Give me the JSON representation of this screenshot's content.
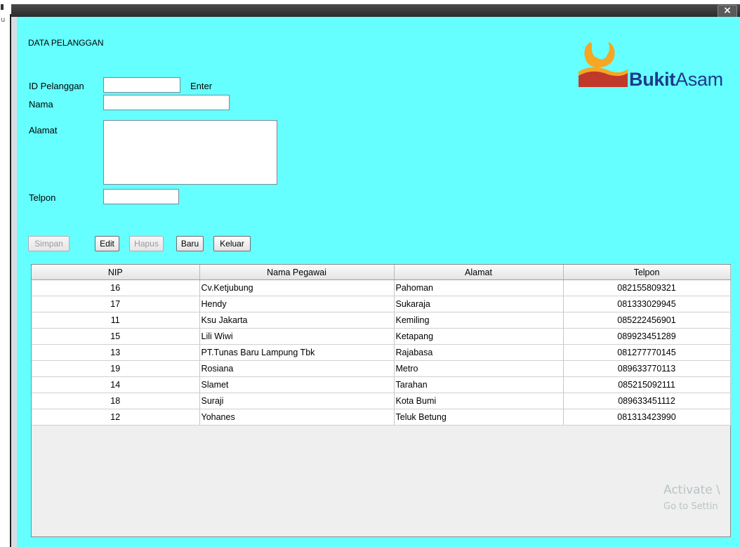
{
  "desktop": {
    "left_char": "u"
  },
  "window": {
    "close_glyph": "×"
  },
  "form": {
    "title": "DATA PELANGGAN",
    "id_label": "ID Pelanggan",
    "id_value": "",
    "enter_label": "Enter",
    "nama_label": "Nama",
    "nama_value": "",
    "alamat_label": "Alamat",
    "alamat_value": "",
    "telpon_label": "Telpon",
    "telpon_value": ""
  },
  "logo": {
    "brand_bold": "Bukit",
    "brand_light": "Asam",
    "colors": {
      "orange": "#f5a623",
      "red": "#c0392b",
      "blue": "#1b3a8c"
    }
  },
  "buttons": {
    "simpan": {
      "label": "Simpan",
      "enabled": false
    },
    "edit": {
      "label": "Edit",
      "enabled": true
    },
    "hapus": {
      "label": "Hapus",
      "enabled": false
    },
    "baru": {
      "label": "Baru",
      "enabled": true
    },
    "keluar": {
      "label": "Keluar",
      "enabled": true
    }
  },
  "table": {
    "headers": [
      "NIP",
      "Nama Pegawai",
      "Alamat",
      "Telpon"
    ],
    "rows": [
      [
        "16",
        "Cv.Ketjubung",
        "Pahoman",
        "082155809321"
      ],
      [
        "17",
        "Hendy",
        "Sukaraja",
        "081333029945"
      ],
      [
        "11",
        "Ksu Jakarta",
        "Kemiling",
        "085222456901"
      ],
      [
        "15",
        "Lili Wiwi",
        "Ketapang",
        "089923451289"
      ],
      [
        "13",
        "PT.Tunas Baru Lampung Tbk",
        "Rajabasa",
        "081277770145"
      ],
      [
        "19",
        "Rosiana",
        "Metro",
        "089633770113"
      ],
      [
        "14",
        "Slamet",
        "Tarahan",
        "085215092111"
      ],
      [
        "18",
        "Suraji",
        "Kota Bumi",
        "089633451112"
      ],
      [
        "12",
        "Yohanes",
        "Teluk Betung",
        "081313423990"
      ]
    ]
  },
  "watermark": {
    "line1": "Activate \\",
    "line2": "Go to Settin"
  },
  "colors": {
    "panel_bg": "#66ffff"
  }
}
